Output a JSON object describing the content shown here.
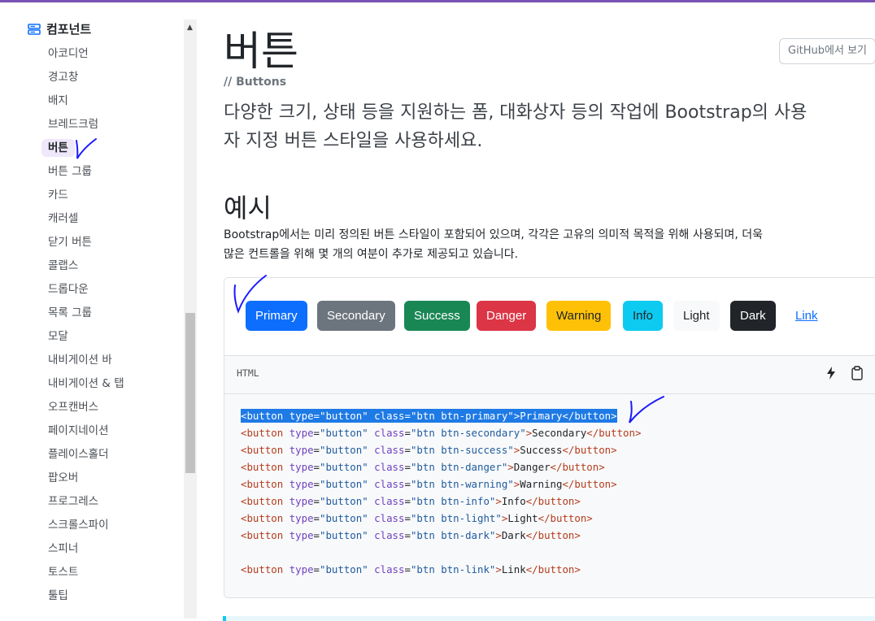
{
  "sidebar": {
    "section": "컴포넌트",
    "items": [
      {
        "label": "아코디언"
      },
      {
        "label": "경고창"
      },
      {
        "label": "배지"
      },
      {
        "label": "브레드크럼"
      },
      {
        "label": "버튼",
        "active": true
      },
      {
        "label": "버튼 그룹"
      },
      {
        "label": "카드"
      },
      {
        "label": "캐러셀"
      },
      {
        "label": "닫기 버튼"
      },
      {
        "label": "콜랩스"
      },
      {
        "label": "드롭다운"
      },
      {
        "label": "목록 그룹"
      },
      {
        "label": "모달"
      },
      {
        "label": "내비게이션 바"
      },
      {
        "label": "내비게이션 & 탭"
      },
      {
        "label": "오프캔버스"
      },
      {
        "label": "페이지네이션"
      },
      {
        "label": "플레이스홀더"
      },
      {
        "label": "팝오버"
      },
      {
        "label": "프로그레스"
      },
      {
        "label": "스크롤스파이"
      },
      {
        "label": "스피너"
      },
      {
        "label": "토스트"
      },
      {
        "label": "툴팁"
      }
    ]
  },
  "main": {
    "title": "버튼",
    "subtitle": "// Buttons",
    "github_button": "GitHub에서 보기",
    "lead_line1": "다양한 크기, 상태 등을 지원하는 폼, 대화상자 등의 작업에 Bootstrap의 사용",
    "lead_line2": "자 지정 버튼 스타일을 사용하세요.",
    "section_title": "예시",
    "para_line1": "Bootstrap에서는 미리 정의된 버튼 스타일이 포함되어 있으며, 각각은 고유의 의미적 목적을 위해 사용되며, 더욱",
    "para_line2": "많은 컨트롤을 위해 몇 개의 여분이 추가로 제공되고 있습니다."
  },
  "example_buttons": {
    "primary": "Primary",
    "secondary": "Secondary",
    "success": "Success",
    "danger": "Danger",
    "warning": "Warning",
    "info": "Info",
    "light": "Light",
    "dark": "Dark",
    "link": "Link"
  },
  "code": {
    "language": "HTML",
    "lines": [
      "<button type=\"button\" class=\"btn btn-primary\">Primary</button>",
      "<button type=\"button\" class=\"btn btn-secondary\">Secondary</button>",
      "<button type=\"button\" class=\"btn btn-success\">Success</button>",
      "<button type=\"button\" class=\"btn btn-danger\">Danger</button>",
      "<button type=\"button\" class=\"btn btn-warning\">Warning</button>",
      "<button type=\"button\" class=\"btn btn-info\">Info</button>",
      "<button type=\"button\" class=\"btn btn-light\">Light</button>",
      "<button type=\"button\" class=\"btn btn-dark\">Dark</button>",
      "",
      "<button type=\"button\" class=\"btn btn-link\">Link</button>"
    ]
  },
  "colors": {
    "primary": "#0d6efd",
    "secondary": "#6c757d",
    "success": "#198754",
    "danger": "#dc3545",
    "warning": "#ffc107",
    "info": "#0dcaf0",
    "light": "#f8f9fa",
    "dark": "#212529",
    "brand": "#7952b3"
  }
}
